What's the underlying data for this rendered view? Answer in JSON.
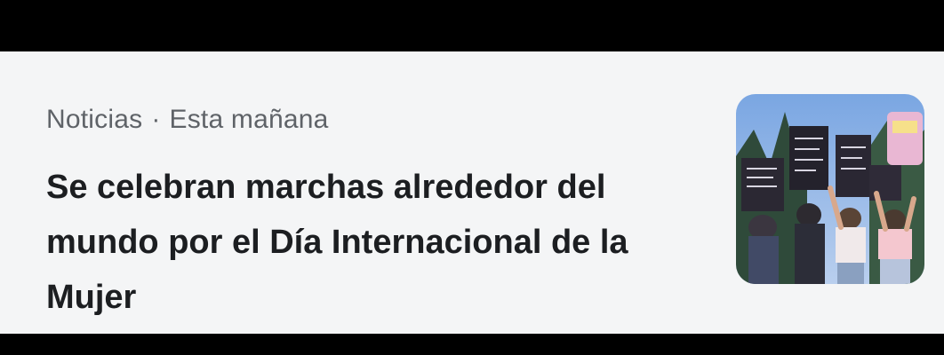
{
  "news_item": {
    "source": "Noticias",
    "separator": "·",
    "time": "Esta mañana",
    "headline": "Se celebran marchas alrededor del mundo por el Día Internacional de la Mujer",
    "thumbnail": {
      "icon": "protest-photo",
      "accent_colors": [
        "#8fb3e6",
        "#2e2a38",
        "#e7b9d1",
        "#f2c6cf"
      ]
    }
  }
}
